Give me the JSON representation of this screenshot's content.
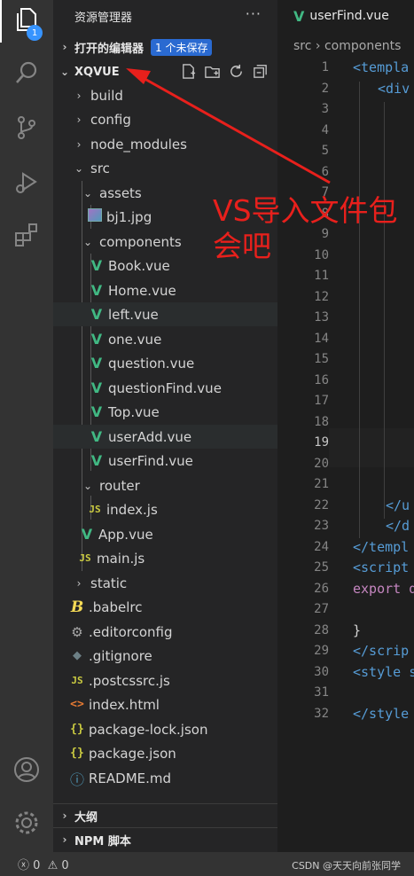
{
  "activity_bar": {
    "explorer_badge": "1",
    "icons": [
      "files-icon",
      "search-icon",
      "source-control-icon",
      "run-debug-icon",
      "extensions-icon",
      "account-icon",
      "settings-gear-icon"
    ]
  },
  "sidebar": {
    "title": "资源管理器",
    "more": "···",
    "open_editors": {
      "label": "打开的编辑器",
      "badge": "1 个未保存"
    },
    "project": {
      "label": "XQVUE"
    },
    "tree": [
      {
        "label": "build",
        "kind": "folder",
        "expanded": false
      },
      {
        "label": "config",
        "kind": "folder",
        "expanded": false
      },
      {
        "label": "node_modules",
        "kind": "folder",
        "expanded": false
      },
      {
        "label": "src",
        "kind": "folder",
        "expanded": true
      },
      {
        "label": "assets",
        "kind": "folder",
        "expanded": true
      },
      {
        "label": "bj1.jpg",
        "kind": "image"
      },
      {
        "label": "components",
        "kind": "folder",
        "expanded": true
      },
      {
        "label": "Book.vue",
        "kind": "vue"
      },
      {
        "label": "Home.vue",
        "kind": "vue"
      },
      {
        "label": "left.vue",
        "kind": "vue"
      },
      {
        "label": "one.vue",
        "kind": "vue"
      },
      {
        "label": "question.vue",
        "kind": "vue"
      },
      {
        "label": "questionFind.vue",
        "kind": "vue"
      },
      {
        "label": "Top.vue",
        "kind": "vue"
      },
      {
        "label": "userAdd.vue",
        "kind": "vue"
      },
      {
        "label": "userFind.vue",
        "kind": "vue"
      },
      {
        "label": "router",
        "kind": "folder",
        "expanded": true
      },
      {
        "label": "index.js",
        "kind": "js"
      },
      {
        "label": "App.vue",
        "kind": "vue"
      },
      {
        "label": "main.js",
        "kind": "js"
      },
      {
        "label": "static",
        "kind": "folder",
        "expanded": false
      },
      {
        "label": ".babelrc",
        "kind": "babel"
      },
      {
        "label": ".editorconfig",
        "kind": "config"
      },
      {
        "label": ".gitignore",
        "kind": "git"
      },
      {
        "label": ".postcssrc.js",
        "kind": "js"
      },
      {
        "label": "index.html",
        "kind": "html"
      },
      {
        "label": "package-lock.json",
        "kind": "json"
      },
      {
        "label": "package.json",
        "kind": "json"
      },
      {
        "label": "README.md",
        "kind": "info"
      }
    ],
    "outline": "大纲",
    "npm": "NPM 脚本"
  },
  "editor": {
    "tab_label": "userFind.vue",
    "breadcrumb": [
      "src",
      "components"
    ],
    "line_numbers": [
      "1",
      "2",
      "3",
      "4",
      "5",
      "6",
      "7",
      "8",
      "9",
      "10",
      "11",
      "12",
      "13",
      "14",
      "15",
      "16",
      "17",
      "18",
      "19",
      "20",
      "21",
      "22",
      "23",
      "24",
      "25",
      "26",
      "27",
      "28",
      "29",
      "30",
      "31",
      "32"
    ],
    "current_line": "19",
    "code": {
      "l1": "<templa",
      "l2": "<div",
      "l22": "</u",
      "l23": "</d",
      "l24": "</templ",
      "l25": "<script",
      "l26": "export d",
      "l28": "}",
      "l29": "</scrip",
      "l30": "<style s",
      "l32": "</style"
    }
  },
  "status_bar": {
    "errors": "0",
    "warnings": "0",
    "watermark": "CSDN @天天向前张同学"
  },
  "annotation": {
    "text": "VS导入文件包会吧",
    "color": "#e8201c"
  }
}
